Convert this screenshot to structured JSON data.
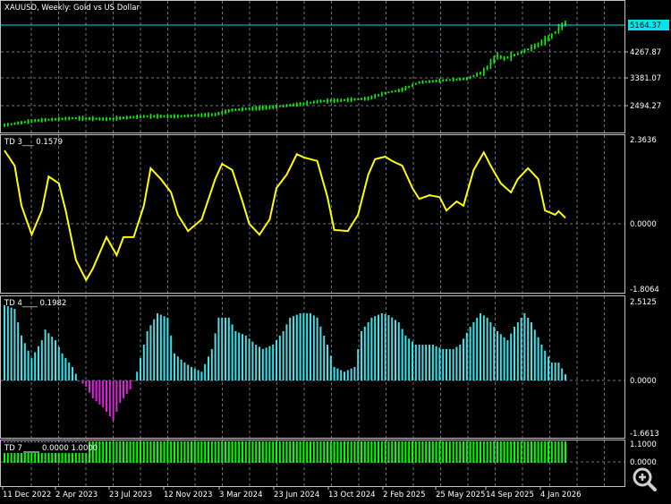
{
  "title": "XAUUSD, Weekly:  Gold vs US Dollar",
  "colors": {
    "background": "#000000",
    "price_bars": "#00ff00",
    "current_price": "#00e5ee",
    "td3_line": "#ffff00",
    "td4_positive": "#40e0e8",
    "td4_negative": "#e020e0",
    "td7_bars": "#00ff00",
    "grid": "#6a7480",
    "frame": "#c0c0c0"
  },
  "main": {
    "current_price": "5164.37",
    "price_ticks": [
      "4267.87",
      "3381.07",
      "2494.27"
    ],
    "price_series": [
      [
        0,
        1850
      ],
      [
        9,
        2000
      ],
      [
        20,
        2080
      ],
      [
        30,
        2050
      ],
      [
        41,
        2140
      ],
      [
        51,
        2140
      ],
      [
        62,
        2200
      ],
      [
        67,
        2350
      ],
      [
        78,
        2440
      ],
      [
        86,
        2530
      ],
      [
        93,
        2640
      ],
      [
        99,
        2670
      ],
      [
        107,
        2730
      ],
      [
        112,
        2910
      ],
      [
        117,
        3020
      ],
      [
        122,
        3260
      ],
      [
        128,
        3320
      ],
      [
        136,
        3380
      ],
      [
        141,
        3610
      ],
      [
        145,
        4140
      ],
      [
        147,
        4050
      ],
      [
        151,
        4200
      ],
      [
        157,
        4500
      ],
      [
        161,
        4790
      ],
      [
        163,
        5030
      ],
      [
        165,
        5200
      ]
    ]
  },
  "td3": {
    "label": "TD 3___ 0.1579",
    "ticks": [
      "2.3636",
      "0.0000",
      "-1.8064"
    ],
    "series": [
      [
        0,
        2.03
      ],
      [
        3,
        1.61
      ],
      [
        5,
        0.5
      ],
      [
        8,
        -0.3
      ],
      [
        11,
        0.37
      ],
      [
        13,
        1.31
      ],
      [
        16,
        1.12
      ],
      [
        18,
        0.37
      ],
      [
        21,
        -1.0
      ],
      [
        24,
        -1.56
      ],
      [
        26,
        -1.24
      ],
      [
        30,
        -0.37
      ],
      [
        33,
        -0.87
      ],
      [
        35,
        -0.37
      ],
      [
        38,
        -0.37
      ],
      [
        41,
        0.5
      ],
      [
        43,
        1.54
      ],
      [
        46,
        1.24
      ],
      [
        49,
        0.87
      ],
      [
        51,
        0.25
      ],
      [
        54,
        -0.2
      ],
      [
        58,
        0.12
      ],
      [
        62,
        1.24
      ],
      [
        64,
        1.66
      ],
      [
        67,
        1.49
      ],
      [
        70,
        0.62
      ],
      [
        72,
        0
      ],
      [
        75,
        -0.3
      ],
      [
        78,
        0.12
      ],
      [
        80,
        0.99
      ],
      [
        83,
        1.36
      ],
      [
        86,
        1.93
      ],
      [
        88,
        1.84
      ],
      [
        92,
        1.74
      ],
      [
        95,
        0.74
      ],
      [
        97,
        -0.17
      ],
      [
        101,
        -0.2
      ],
      [
        104,
        0.25
      ],
      [
        107,
        1.36
      ],
      [
        109,
        1.79
      ],
      [
        112,
        1.86
      ],
      [
        114,
        1.74
      ],
      [
        117,
        1.61
      ],
      [
        120,
        0.99
      ],
      [
        122,
        0.69
      ],
      [
        125,
        0.79
      ],
      [
        128,
        0.74
      ],
      [
        130,
        0.37
      ],
      [
        133,
        0.62
      ],
      [
        135,
        0.5
      ],
      [
        138,
        1.49
      ],
      [
        141,
        1.98
      ],
      [
        143,
        1.61
      ],
      [
        146,
        1.12
      ],
      [
        149,
        0.87
      ],
      [
        151,
        1.24
      ],
      [
        154,
        1.54
      ],
      [
        157,
        1.24
      ],
      [
        159,
        0.37
      ],
      [
        162,
        0.25
      ],
      [
        163,
        0.35
      ],
      [
        165,
        0.16
      ]
    ]
  },
  "td4": {
    "label": "TD 4____ 0.1982",
    "ticks": [
      "2.5125",
      "0.0000",
      "-1.6613"
    ],
    "series": [
      [
        0,
        2.4
      ],
      [
        3,
        2.28
      ],
      [
        5,
        1.43
      ],
      [
        8,
        0.71
      ],
      [
        11,
        1.28
      ],
      [
        12,
        1.62
      ],
      [
        15,
        1.28
      ],
      [
        17,
        0.86
      ],
      [
        20,
        0.43
      ],
      [
        22,
        0
      ],
      [
        24,
        -0.2
      ],
      [
        26,
        -0.57
      ],
      [
        29,
        -0.86
      ],
      [
        32,
        -1.28
      ],
      [
        34,
        -0.71
      ],
      [
        37,
        -0.28
      ],
      [
        39,
        0.28
      ],
      [
        42,
        1.57
      ],
      [
        45,
        2.14
      ],
      [
        48,
        2.0
      ],
      [
        50,
        0.86
      ],
      [
        53,
        0.57
      ],
      [
        55,
        0.43
      ],
      [
        58,
        0.28
      ],
      [
        61,
        1.0
      ],
      [
        63,
        2.0
      ],
      [
        66,
        2.0
      ],
      [
        68,
        1.57
      ],
      [
        71,
        1.43
      ],
      [
        74,
        1.14
      ],
      [
        76,
        1.0
      ],
      [
        79,
        1.14
      ],
      [
        82,
        1.57
      ],
      [
        84,
        2.0
      ],
      [
        87,
        2.14
      ],
      [
        90,
        2.14
      ],
      [
        92,
        2.0
      ],
      [
        95,
        1.14
      ],
      [
        97,
        0.43
      ],
      [
        100,
        0.28
      ],
      [
        103,
        0.43
      ],
      [
        105,
        1.57
      ],
      [
        108,
        2.0
      ],
      [
        111,
        2.14
      ],
      [
        113,
        2.08
      ],
      [
        116,
        1.85
      ],
      [
        118,
        1.43
      ],
      [
        121,
        1.14
      ],
      [
        124,
        1.14
      ],
      [
        126,
        1.14
      ],
      [
        129,
        1.0
      ],
      [
        132,
        1.0
      ],
      [
        134,
        1.14
      ],
      [
        137,
        1.71
      ],
      [
        140,
        2.14
      ],
      [
        142,
        2.0
      ],
      [
        145,
        1.57
      ],
      [
        148,
        1.28
      ],
      [
        150,
        1.71
      ],
      [
        153,
        2.14
      ],
      [
        155,
        1.85
      ],
      [
        158,
        1.14
      ],
      [
        161,
        0.57
      ],
      [
        163,
        0.57
      ],
      [
        165,
        0.2
      ]
    ]
  },
  "td7": {
    "label_name": "TD 7",
    "label_values": "0.0000 1.0000",
    "ticks": [
      "1.1000",
      "0.0000"
    ],
    "value": 1.0
  },
  "time_axis": [
    "11 Dec 2022",
    "2 Apr 2023",
    "23 Jul 2023",
    "12 Nov 2023",
    "3 Mar 2024",
    "23 Jun 2024",
    "13 Oct 2024",
    "2 Feb 2025",
    "25 May 2025",
    "14 Sep 2025",
    "4 Jan 2026"
  ],
  "zoom_icon": "magnifier-plus-icon"
}
